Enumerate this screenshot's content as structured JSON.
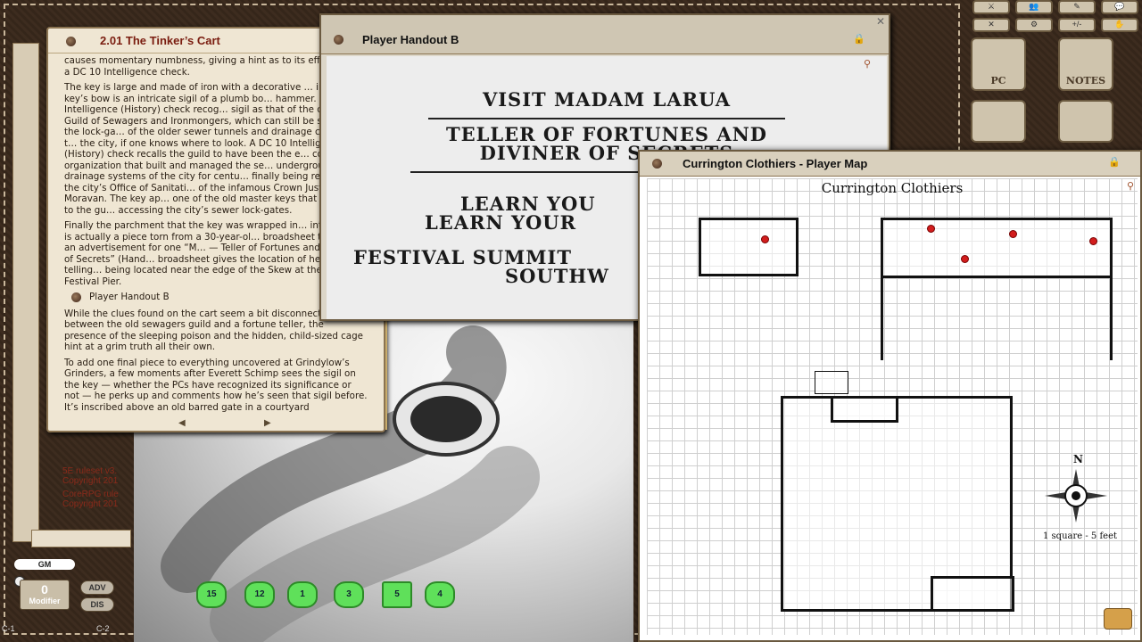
{
  "story": {
    "title": "2.01 The Tinker’s Cart",
    "paragraphs": [
      "causes momentary numbness, giving a hint as to its effects with a DC 10 Intelligence check.",
      "The key is large and made of iron with a decorative … into the key’s bow is an intricate sigil of a plumb bo… hammer. A DC 10 Intelligence (History) check recog… sigil as that of the city’s old Guild of Sewagers and Ironmongers, which can still be seen on the lock-ga… of the older sewer tunnels and drainage channels t… the city, if one knows where to look. A DC 10 Intellig… (History) check recalls the guild to have been the e… corrupt organization that built and managed the se… underground drainage systems of the city for centu… finally being replaced by the city’s Office of Sanitati… of the infamous Crown Justice Moravan. The key ap… one of the old master keys that belonged to the gu… accessing the city’s sewer lock-gates.",
      "Finally the parchment that the key was wrapped in… interest. It is actually a piece torn from a 30-year-ol… broadsheet that bears an advertisement for one “M… — Teller of Fortunes and Diviner of Secrets” (Hand… broadsheet gives the location of her fortune-telling… being located near the edge of the Skew at the sum… Festival Pier."
    ],
    "link_label": "Player Handout B",
    "paragraphs2": [
      "While the clues found on the cart seem a bit disconnected between the old sewagers guild and a fortune teller, the presence of the sleeping poison and the hidden, child-sized cage hint at a grim truth all their own.",
      "To add one final piece to everything uncovered at Grindylow’s Grinders, a few moments after Everett Schimp sees the sigil on the key — whether the PCs have recognized its significance or not — he perks up and comments how he’s seen that sigil before. It’s inscribed above an old barred gate in a courtyard"
    ],
    "nav_prev": "◀",
    "nav_next": "▶"
  },
  "handout": {
    "title": "Player Handout B",
    "lines": [
      "VISIT MADAM LARUA",
      "TELLER OF FORTUNES AND",
      "DIVINER OF SECRETS",
      "LEARN YOU",
      "LEARN YOUR",
      "FESTIVAL SUMMIT",
      "SOUTHW"
    ]
  },
  "map": {
    "window_title": "Currington Clothiers - Player Map",
    "map_title": "Currington Clothiers",
    "compass": "N",
    "scale": "1 square - 5 feet"
  },
  "sidebar": {
    "license1_a": "5E ruleset v3.",
    "license1_b": "Copyright 201",
    "license2_a": "CoreRPG rule",
    "license2_b": "Copyright 201",
    "gm": "GM",
    "modifier_value": "0",
    "modifier_label": "Modifier",
    "adv": "ADV",
    "dis": "DIS",
    "c1": "C-1",
    "c2": "C-2"
  },
  "menu": {
    "pc": "PC",
    "notes": "NOTES"
  },
  "dice": [
    "d20",
    "d12",
    "d10",
    "d8",
    "d6",
    "d4"
  ],
  "dice_faces": [
    "15",
    "12",
    "1",
    "3",
    "5",
    "4"
  ],
  "colors": {
    "dice": "#5fe05a",
    "title_red": "#7a1d10",
    "pin": "#d21d1d"
  }
}
